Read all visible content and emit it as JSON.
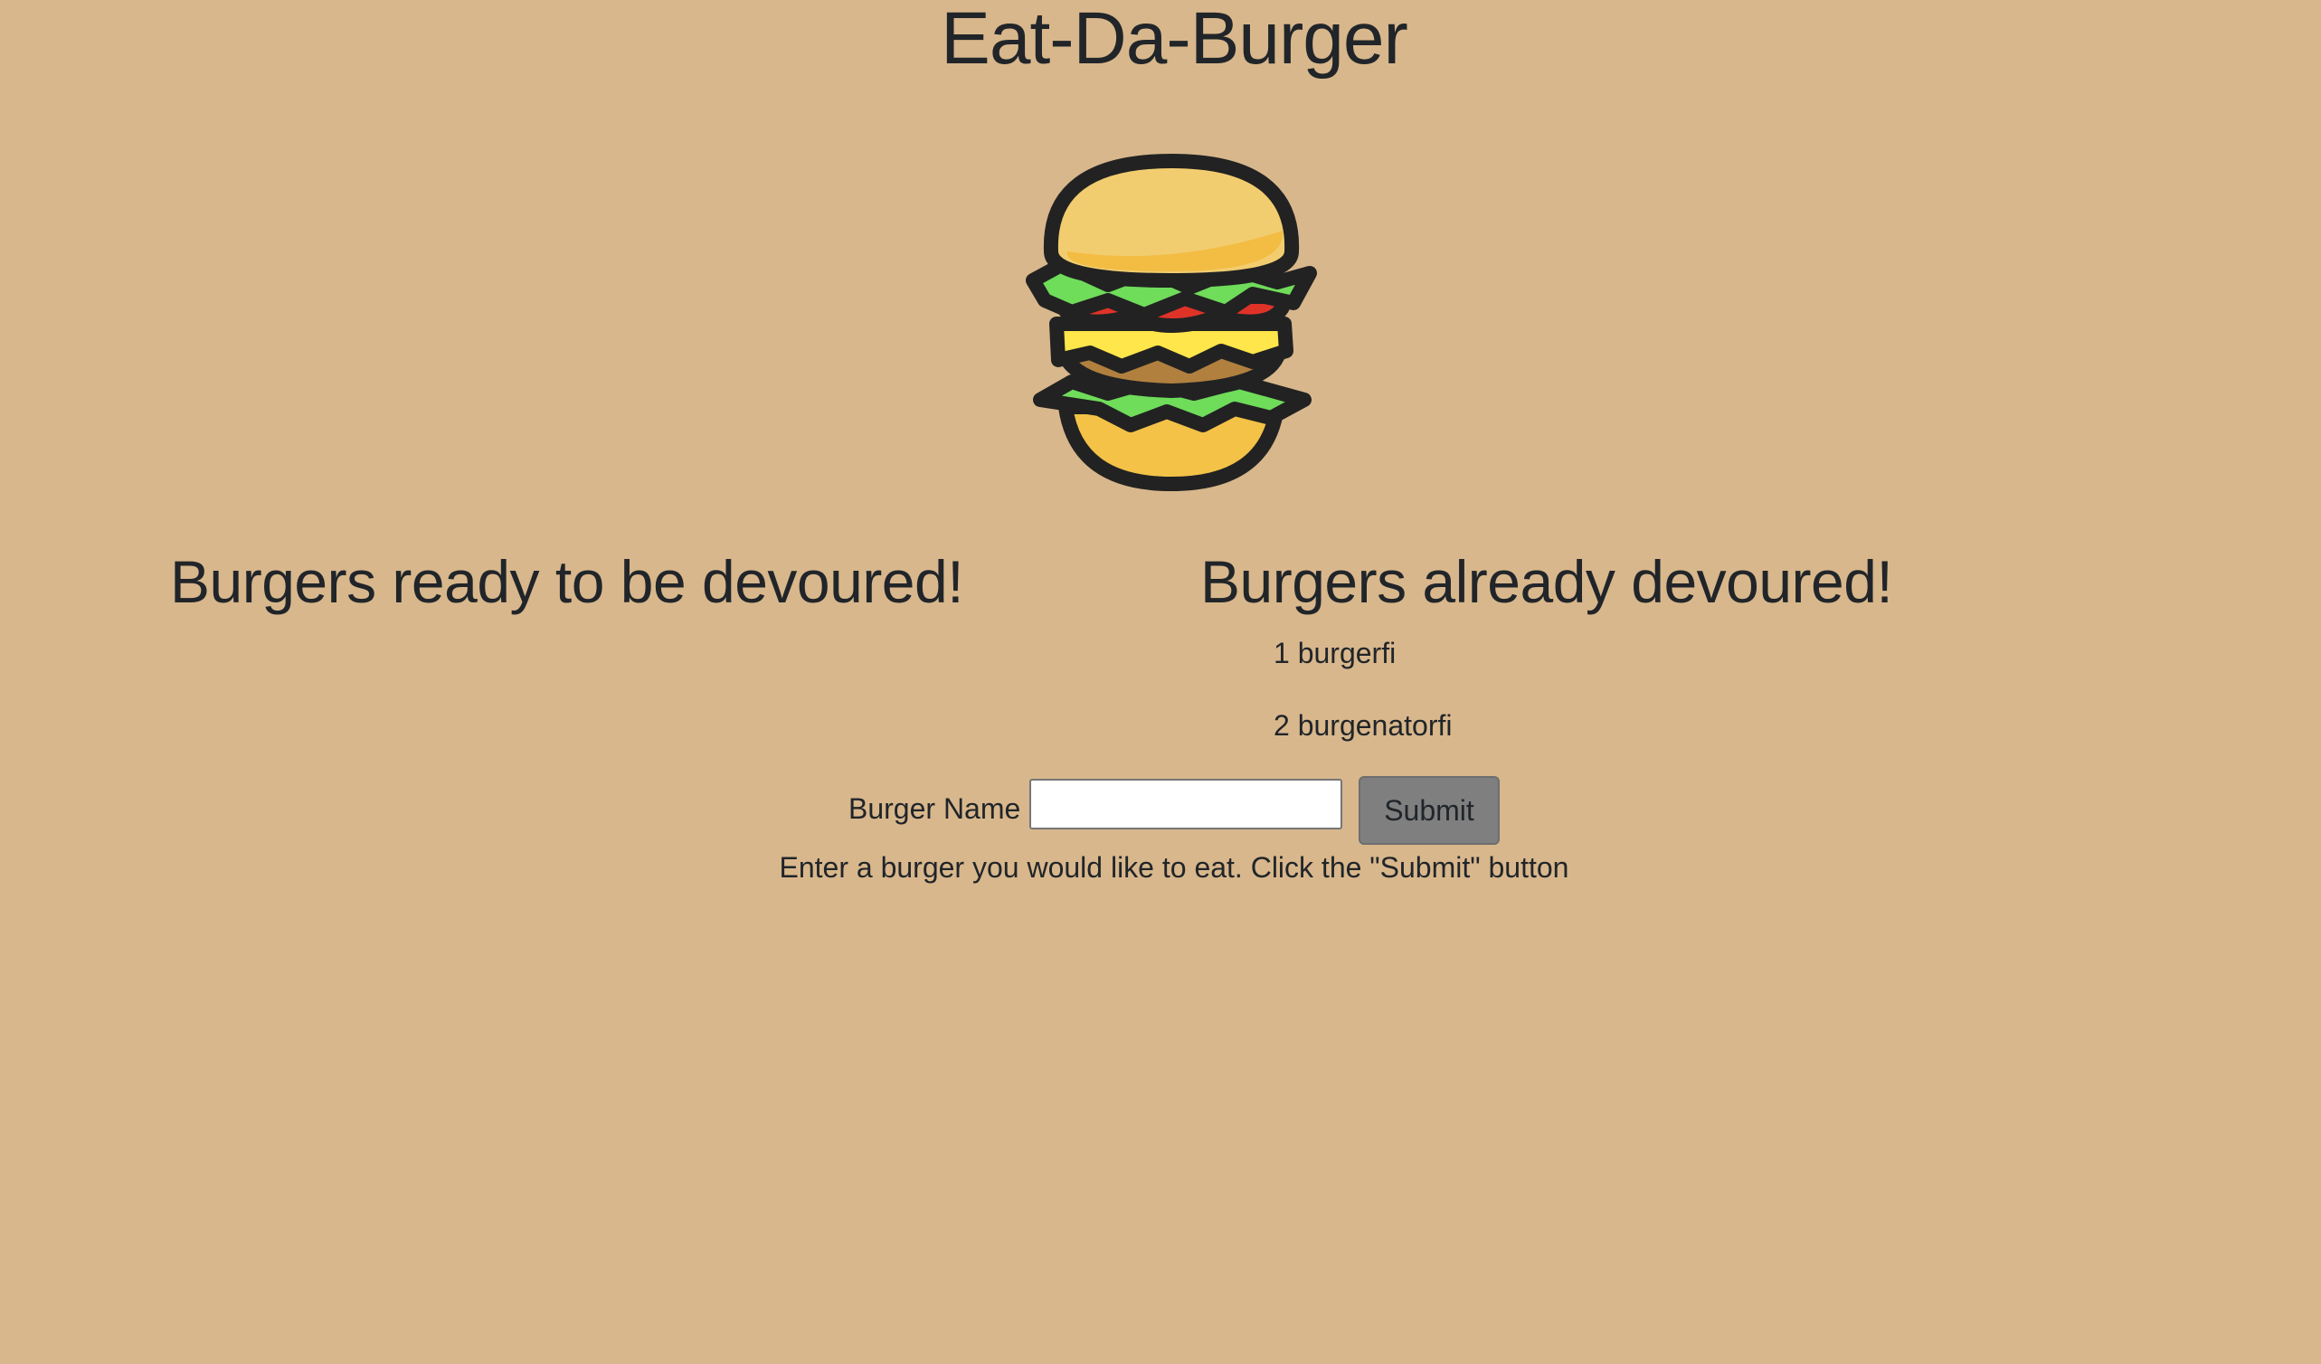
{
  "header": {
    "title": "Eat-Da-Burger",
    "logo_icon": "burger-icon"
  },
  "ready_column": {
    "heading": "Burgers ready to be devoured!",
    "items": []
  },
  "devoured_column": {
    "heading": "Burgers already devoured!",
    "items": [
      {
        "label": "1 burgerfi"
      },
      {
        "label": "2 burgenatorfi"
      }
    ]
  },
  "form": {
    "label": "Burger Name",
    "input_value": "",
    "submit_label": "Submit",
    "help_text": "Enter a burger you would like to eat. Click the \"Submit\" button"
  },
  "colors": {
    "background": "#d8b78c",
    "text": "#212529",
    "button": "#7f7f7f"
  }
}
